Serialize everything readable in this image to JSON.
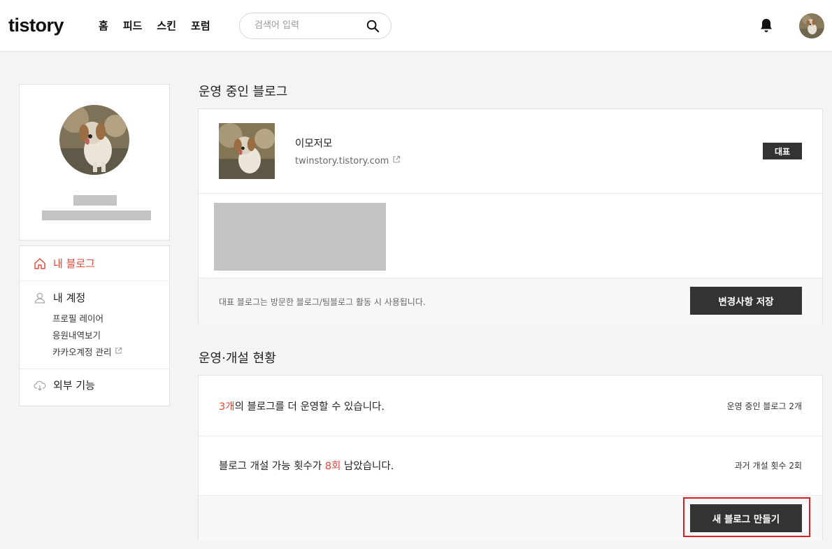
{
  "header": {
    "logo": "tistory",
    "nav": [
      "홈",
      "피드",
      "스킨",
      "포럼"
    ],
    "search_placeholder": "검색어 입력"
  },
  "sidebar": {
    "menu": {
      "my_blog": "내 블로그",
      "my_account": "내 계정",
      "sub_items": [
        "프로필 레이어",
        "응원내역보기",
        "카카오계정 관리"
      ],
      "external": "외부 기능"
    }
  },
  "blogs_section": {
    "title": "운영 중인 블로그",
    "blog": {
      "name": "이모저모",
      "url": "twinstory.tistory.com",
      "badge": "대표"
    },
    "footer_note": "대표 블로그는 방문한 블로그/팀블로그 활동 시 사용됩니다.",
    "save_button": "변경사항 저장"
  },
  "status_section": {
    "title": "운영·개설 현황",
    "row1": {
      "count": "3개",
      "text": "의 블로그를 더 운영할 수 있습니다.",
      "right": "운영 중인 블로그 2개"
    },
    "row2": {
      "prefix": "블로그 개설 가능 횟수가 ",
      "count": "8회",
      "suffix": " 남았습니다.",
      "right": "과거 개설 횟수 2회"
    },
    "new_blog_button": "새 블로그 만들기"
  },
  "colors": {
    "accent": "#e2473a",
    "dark_button": "#333333",
    "highlight_box": "#e01e1e"
  }
}
